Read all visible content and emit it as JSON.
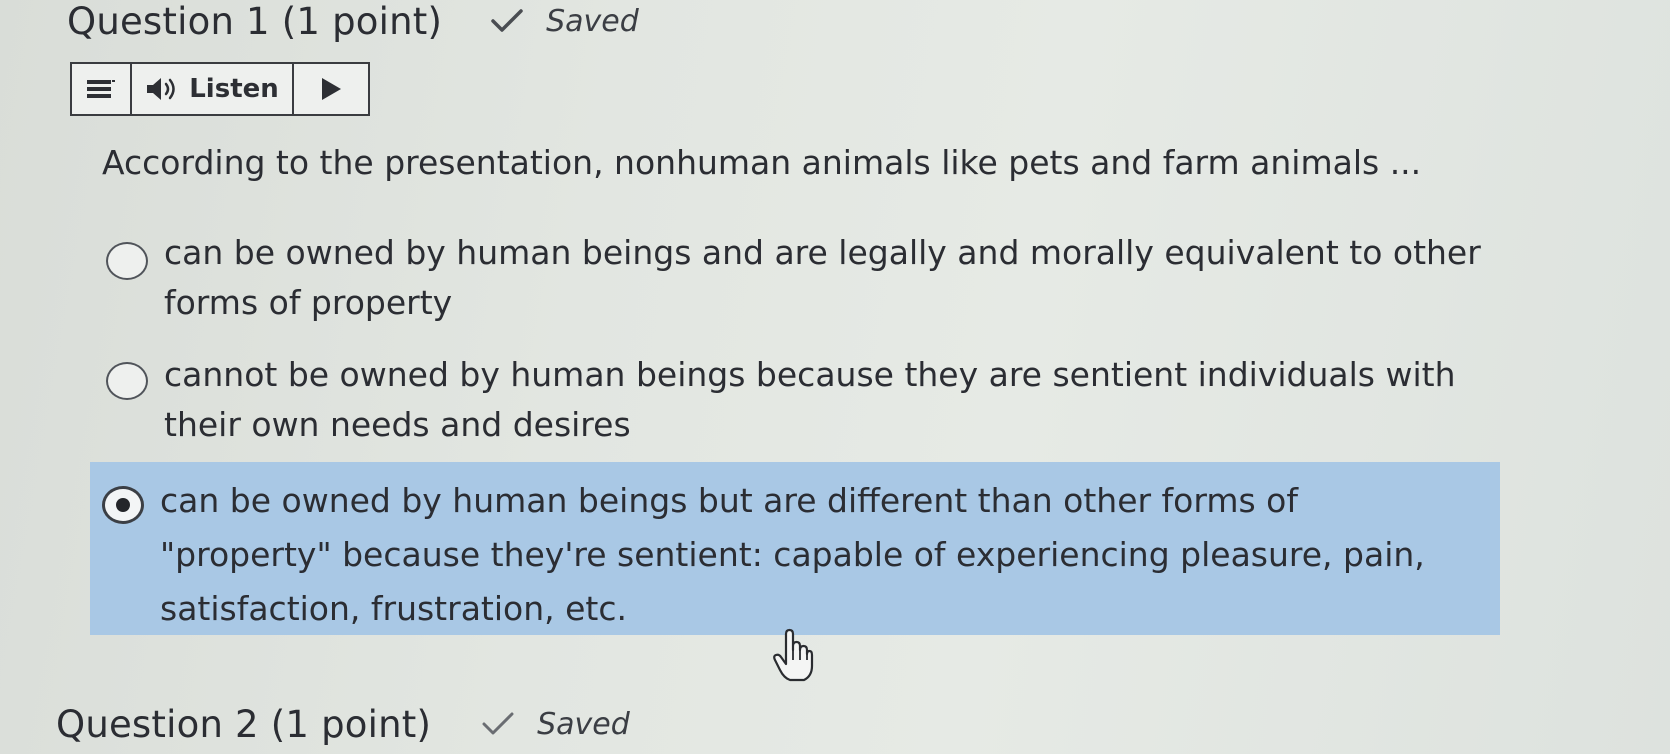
{
  "question1": {
    "title": "Question 1",
    "points": "(1 point)",
    "status": "Saved",
    "status_icon": "check-icon",
    "listen_bar": {
      "menu_icon": "menu-icon",
      "speaker_icon": "speaker-icon",
      "listen_label": "Listen",
      "play_icon": "play-icon"
    },
    "prompt": "According to the presentation, nonhuman animals like pets and farm animals ...",
    "options": [
      {
        "text": "can be owned by human beings and are legally and morally equivalent to other forms of property",
        "selected": false
      },
      {
        "text": "cannot be owned by human beings because they are sentient individuals with their own needs and desires",
        "selected": false
      },
      {
        "text": "can be owned by human beings but are different than other forms of \"property\" because they're sentient: capable of experiencing pleasure, pain, satisfaction, frustration, etc.",
        "selected": true
      }
    ],
    "selected_color": "#a9c8e5"
  },
  "question2": {
    "title": "Question 2",
    "points": "(1 point)",
    "status": "Saved",
    "status_icon": "check-icon"
  },
  "cursor_icon": "hand-pointer-icon"
}
